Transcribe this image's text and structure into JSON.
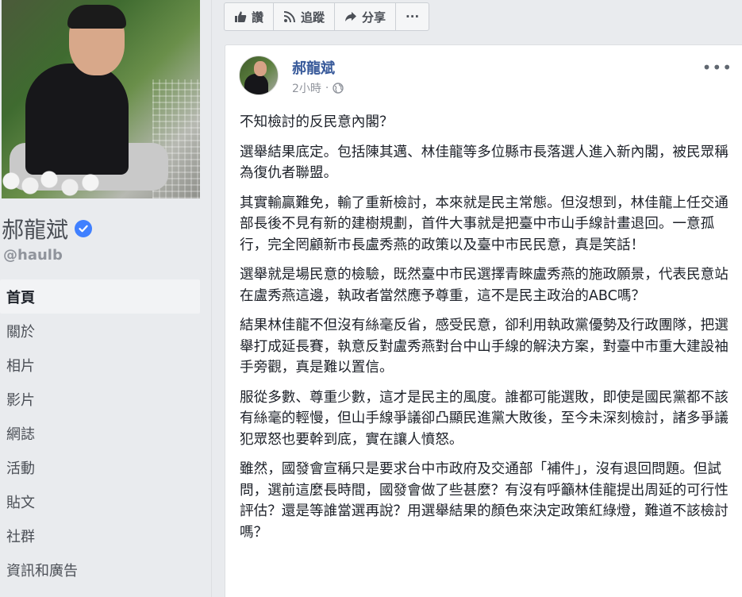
{
  "profile": {
    "page_name": "郝龍斌",
    "handle": "@haulb",
    "verified": true
  },
  "nav": {
    "items": [
      {
        "label": "首頁",
        "active": true
      },
      {
        "label": "關於",
        "active": false
      },
      {
        "label": "相片",
        "active": false
      },
      {
        "label": "影片",
        "active": false
      },
      {
        "label": "網誌",
        "active": false
      },
      {
        "label": "活動",
        "active": false
      },
      {
        "label": "貼文",
        "active": false
      },
      {
        "label": "社群",
        "active": false
      },
      {
        "label": "資訊和廣告",
        "active": false
      }
    ]
  },
  "actions": {
    "like": "讚",
    "follow": "追蹤",
    "share": "分享",
    "more": "···"
  },
  "post": {
    "author": "郝龍斌",
    "time": "2小時",
    "privacy_icon": "globe-icon",
    "more": "•••",
    "paragraphs": [
      "不知檢討的反民意內閣？",
      "選舉結果底定。包括陳其邁、林佳龍等多位縣市長落選人進入新內閣，被民眾稱為復仇者聯盟。",
      "其實輸贏難免，輸了重新檢討，本來就是民主常態。但沒想到，林佳龍上任交通部長後不見有新的建樹規劃，首件大事就是把臺中市山手線計畫退回。一意孤行，完全罔顧新市長盧秀燕的政策以及臺中市民民意，真是笑話！",
      "選舉就是場民意的檢驗，既然臺中市民選擇青睞盧秀燕的施政願景，代表民意站在盧秀燕這邊，執政者當然應予尊重，這不是民主政治的ABC嗎？",
      "結果林佳龍不但沒有絲毫反省，感受民意，卻利用執政黨優勢及行政團隊，把選舉打成延長賽，執意反對盧秀燕對台中山手線的解決方案，對臺中市重大建設袖手旁觀，真是難以置信。",
      "服從多數、尊重少數，這才是民主的風度。誰都可能選敗，即使是國民黨都不該有絲毫的輕慢，但山手線爭議卻凸顯民進黨大敗後，至今未深刻檢討，諸多爭議犯眾怒也要幹到底，實在讓人憤怒。",
      "雖然，國發會宣稱只是要求台中市政府及交通部「補件」，沒有退回問題。但試問，選前這麼長時間，國發會做了些甚麼？有沒有呼籲林佳龍提出周延的可行性評估？還是等誰當選再說？用選舉結果的顏色來決定政策紅綠燈，難道不該檢討嗎？"
    ]
  },
  "colors": {
    "link": "#365899",
    "verified": "#4080ff",
    "background": "#e9ebee"
  }
}
